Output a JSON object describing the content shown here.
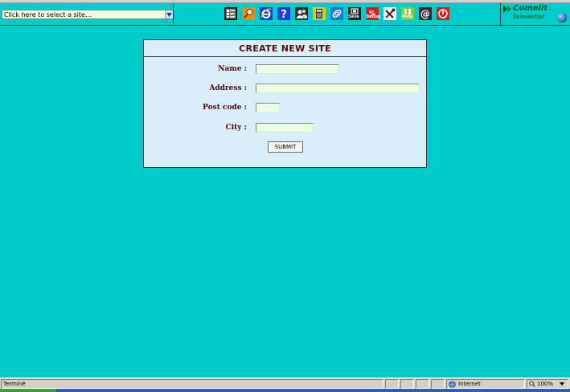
{
  "site_selector": {
    "selected_value": "Click here to select a site..."
  },
  "toolbar": {
    "icons": [
      {
        "name": "list-icon"
      },
      {
        "name": "search-icon"
      },
      {
        "name": "ie-icon"
      },
      {
        "name": "help-icon"
      },
      {
        "name": "users-icon"
      },
      {
        "name": "phone-icon"
      },
      {
        "name": "link-icon"
      },
      {
        "name": "save-icon",
        "label": "Save"
      },
      {
        "name": "debug-icon",
        "label": "Debug"
      },
      {
        "name": "tools-icon"
      },
      {
        "name": "help-book-icon",
        "label": "Help"
      },
      {
        "name": "email-icon"
      },
      {
        "name": "power-icon"
      }
    ]
  },
  "logo": {
    "brand": "Comelit",
    "product": "Ixmaster"
  },
  "form": {
    "title": "CREATE NEW SITE",
    "fields": {
      "name": {
        "label": "Name :",
        "value": ""
      },
      "address": {
        "label": "Address :",
        "value": ""
      },
      "postcode": {
        "label": "Post code :",
        "value": ""
      },
      "city": {
        "label": "City :",
        "value": ""
      }
    },
    "submit_label": "SUBMIT"
  },
  "status_bar": {
    "status_text": "Terminé",
    "zone": "Internet",
    "zoom": "100%"
  },
  "colors": {
    "background": "#00cccc",
    "panel": "#d9eef8",
    "input": "#ecffe0",
    "label": "#4a0808",
    "title": "#5a0a0a"
  }
}
